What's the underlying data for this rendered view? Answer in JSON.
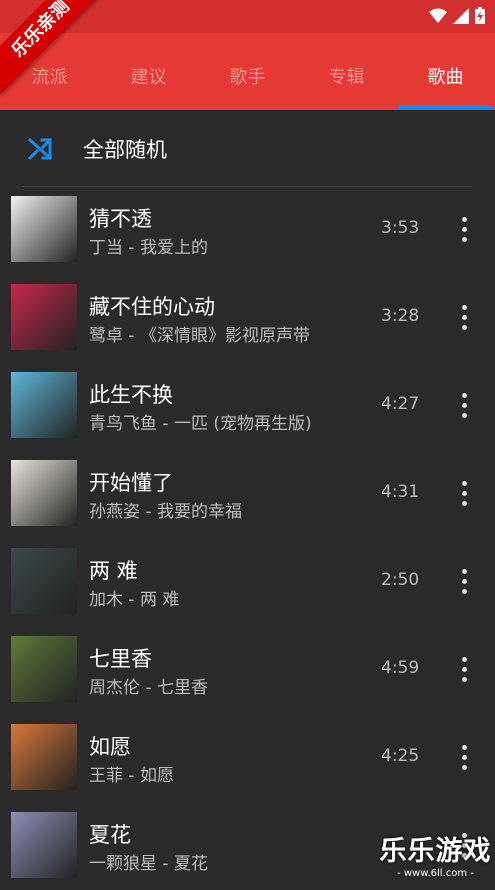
{
  "badge": "乐乐亲测",
  "tabs": [
    "流派",
    "建议",
    "歌手",
    "专辑",
    "歌曲"
  ],
  "active_tab": 4,
  "shuffle": {
    "label": "全部随机",
    "icon": "shuffle-icon"
  },
  "songs": [
    {
      "title": "猜不透",
      "subtitle": "丁当 - 我爱上的",
      "duration": "3:53",
      "art_color": "#f2f2f2"
    },
    {
      "title": "藏不住的心动",
      "subtitle": "鹭卓 - 《深情眼》影视原声带",
      "duration": "3:28",
      "art_color": "#c6284a"
    },
    {
      "title": "此生不换",
      "subtitle": "青鸟飞鱼 - 一匹 (宠物再生版)",
      "duration": "4:27",
      "art_color": "#5fb7d9"
    },
    {
      "title": "开始懂了",
      "subtitle": "孙燕姿 - 我要的幸福",
      "duration": "4:31",
      "art_color": "#e9e6da"
    },
    {
      "title": "两 难",
      "subtitle": "加木 - 两 难",
      "duration": "2:50",
      "art_color": "#3b4a4a"
    },
    {
      "title": "七里香",
      "subtitle": "周杰伦 - 七里香",
      "duration": "4:59",
      "art_color": "#5f7a3d"
    },
    {
      "title": "如愿",
      "subtitle": "王菲 - 如愿",
      "duration": "4:25",
      "art_color": "#d9773a"
    },
    {
      "title": "夏花",
      "subtitle": "一颗狼星 - 夏花",
      "duration": "",
      "art_color": "#8c8fb8"
    }
  ],
  "watermark": {
    "big": "乐乐游戏",
    "small": "- www.6ll.com -"
  }
}
